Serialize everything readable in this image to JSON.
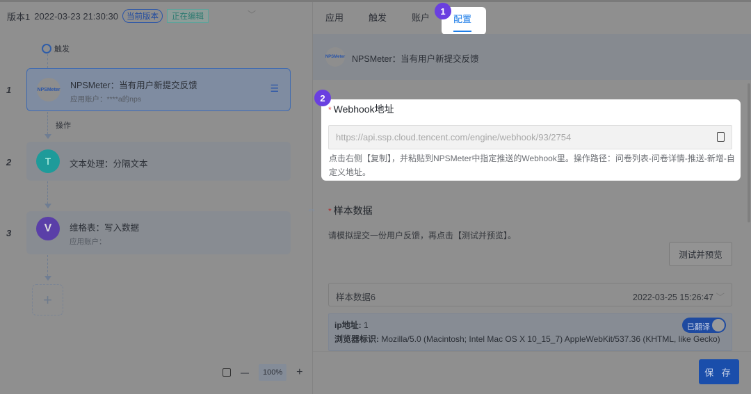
{
  "version": {
    "label": "版本1",
    "datetime": "2022-03-23 21:30:30",
    "current_badge": "当前版本",
    "editing_badge": "正在编辑"
  },
  "flow": {
    "trigger_label": "触发",
    "operation_label": "操作",
    "steps": [
      {
        "num": "1",
        "title": "NPSMeter：当有用户新提交反馈",
        "sub": "应用账户：****a的nps",
        "logo": "NPSMeter"
      },
      {
        "num": "2",
        "title": "文本处理：分隔文本",
        "sub": ""
      },
      {
        "num": "3",
        "title": "维格表：写入数据",
        "sub": "应用账户："
      }
    ],
    "zoom": "100%"
  },
  "tabs": [
    "应用",
    "触发",
    "账户",
    "配置"
  ],
  "markers": [
    "1",
    "2"
  ],
  "header": {
    "logo": "NPSMeter",
    "title": "NPSMeter：当有用户新提交反馈"
  },
  "webhook": {
    "label": "Webhook地址",
    "url": "https://api.ssp.cloud.tencent.com/engine/webhook/93/2754",
    "hint": "点击右侧【复制】，并粘贴到NPSMeter中指定推送的Webhook里。操作路径：问卷列表-问卷详情-推送-新增-自定义地址。"
  },
  "sample": {
    "label": "样本数据",
    "desc": "请模拟提交一份用户反馈，再点击【测试并预览】。",
    "test_button": "测试并预览",
    "selected": "样本数据6",
    "selected_time": "2022-03-25 15:26:47",
    "ip_label": "ip地址:",
    "ip_value": "1",
    "ua_label": "浏览器标识:",
    "ua_value": "Mozilla/5.0 (Macintosh; Intel Mac OS X 10_15_7) AppleWebKit/537.36 (KHTML, like Gecko)",
    "translated": "已翻译"
  },
  "save_button": "保 存"
}
